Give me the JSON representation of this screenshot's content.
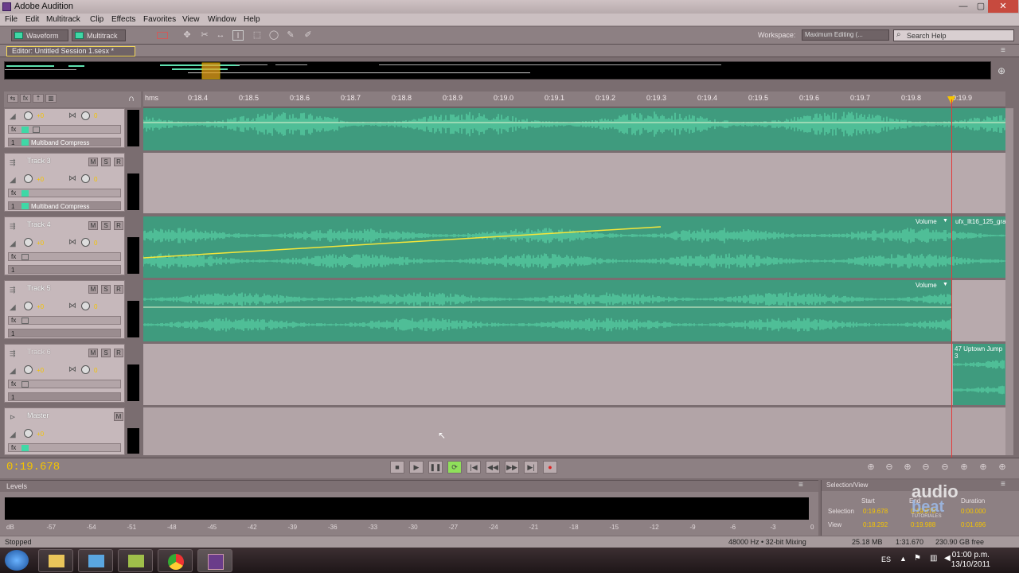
{
  "window": {
    "title": "Adobe Audition",
    "min": "—",
    "max": "▢",
    "close": "✕"
  },
  "menu": [
    "File",
    "Edit",
    "Multitrack",
    "Clip",
    "Effects",
    "Favorites",
    "View",
    "Window",
    "Help"
  ],
  "toolbar": {
    "waveform": "Waveform",
    "multitrack": "Multitrack",
    "workspace_label": "Workspace:",
    "workspace_value": "Maximum Editing (...",
    "search_placeholder": "Search Help"
  },
  "editor_tab": "Editor: Untitled Session 1.sesx *",
  "timeline": {
    "hms": "hms",
    "ticks": [
      "0:18.4",
      "0:18.5",
      "0:18.6",
      "0:18.7",
      "0:18.8",
      "0:18.9",
      "0:19.0",
      "0:19.1",
      "0:19.2",
      "0:19.3",
      "0:19.4",
      "0:19.5",
      "0:19.6",
      "0:19.7",
      "0:19.8",
      "0:19.9"
    ]
  },
  "tracks": [
    {
      "name": "",
      "volume": "+0",
      "pan": "0",
      "effect": "Multiband Compress",
      "channel": "1"
    },
    {
      "name": "Track 3",
      "volume": "+0",
      "pan": "0",
      "effect": "Multiband Compress",
      "channel": "1"
    },
    {
      "name": "Track 4",
      "volume": "+0",
      "pan": "0",
      "effect": "",
      "channel": "1"
    },
    {
      "name": "Track 5",
      "volume": "+0",
      "pan": "0",
      "effect": "",
      "channel": "1"
    },
    {
      "name": "Track 6",
      "volume": "+0",
      "pan": "0",
      "effect": "",
      "channel": "1"
    },
    {
      "name": "Master",
      "volume": "+0",
      "pan": "",
      "effect": "",
      "channel": ""
    }
  ],
  "clips": {
    "track4_volume": "Volume",
    "track4_clip_name": "ufx_llt16_125_gravi",
    "track5_volume": "Volume",
    "track6_clip_name": "47 Uptown Jump 3"
  },
  "transport": {
    "timecode": "0:19.678"
  },
  "levels": {
    "title": "Levels",
    "db_ticks": [
      "dB",
      "-57",
      "-54",
      "-51",
      "-48",
      "-45",
      "-42",
      "-39",
      "-36",
      "-33",
      "-30",
      "-27",
      "-24",
      "-21",
      "-18",
      "-15",
      "-12",
      "-9",
      "-6",
      "-3",
      "0"
    ]
  },
  "selection_view": {
    "title": "Selection/View",
    "col_start": "Start",
    "col_end": "End",
    "col_duration": "Duration",
    "row_selection": "Selection",
    "row_view": "View",
    "selection_start": "0:19.678",
    "selection_end": "0:19.678",
    "selection_duration": "0:00.000",
    "view_start": "0:18.292",
    "view_end": "0:19.988",
    "view_duration": "0:01.696"
  },
  "watermark": {
    "line1": "audio",
    "line2": "beat",
    "line3": "TUTORIALES"
  },
  "status": {
    "left": "Stopped",
    "format": "48000 Hz • 32-bit Mixing",
    "mem": "25.18 MB",
    "dur": "1:31.670",
    "disk": "230.90 GB free"
  },
  "taskbar": {
    "lang": "ES",
    "time": "01:00 p.m.",
    "date": "13/10/2011"
  },
  "colors": {
    "waveform": "#5fe0b0",
    "clip_bg": "#3f9b7e",
    "accent_yellow": "#f5c400",
    "playhead": "#e23a3a"
  }
}
